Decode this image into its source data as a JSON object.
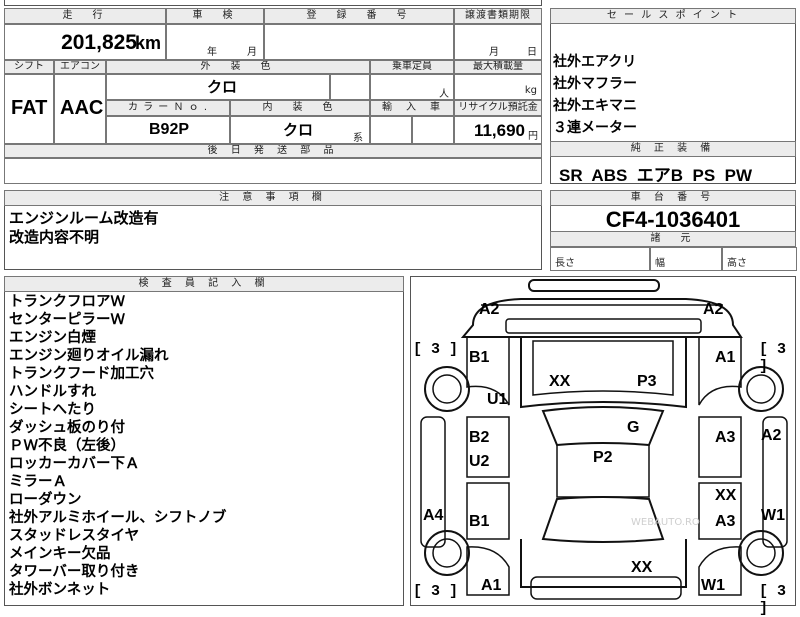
{
  "headers": {
    "mileage": "走　行",
    "inspection": "車　検",
    "registration": "登　録　番　号",
    "transfer_deadline": "譲渡書類期限",
    "sales_point": "セ ー ル ス ポ イ ン ト",
    "shift": "シフト",
    "aircon": "エアコン",
    "exterior_color": "外　装　色",
    "capacity": "乗車定員",
    "max_load": "最大積載量",
    "color_no": "カ ラ ー Ｎ ｏ .",
    "interior_color": "内　装　色",
    "import": "輸　入　車",
    "recycle_fee": "リサイクル預託金",
    "later_parts": "後 日 発 送 部 品",
    "genuine_equipment": "純 正 装 備",
    "notes": "注 意 事 項 欄",
    "chassis_no": "車 台 番 号",
    "specs": "諸　元",
    "inspector": "検 査 員 記 入 欄"
  },
  "values": {
    "mileage": "201,825",
    "mileage_unit": "km",
    "inspection_year": "年",
    "inspection_month": "月",
    "transfer_month": "月",
    "transfer_day": "日",
    "shift": "FAT",
    "aircon": "AAC",
    "exterior_color": "クロ",
    "capacity_unit": "人",
    "max_load_unit": "kg",
    "color_no": "B92P",
    "interior_color": "クロ",
    "interior_suffix": "系",
    "recycle_fee": "11,690",
    "recycle_unit": "円",
    "genuine_equipment": "SR  ABS  エアB  PS  PW",
    "chassis_no": "CF4-1036401",
    "length_label": "長さ",
    "width_label": "幅",
    "height_label": "高さ"
  },
  "sales_points": [
    "社外エアクリ",
    "社外マフラー",
    "社外エキマニ",
    "３連メーター"
  ],
  "notes": [
    "エンジンルーム改造有",
    "改造内容不明"
  ],
  "inspector_notes": [
    "トランクフロアＷ",
    "センターピラーＷ",
    "エンジン白煙",
    "エンジン廻りオイル漏れ",
    "トランクフード加工穴",
    "ハンドルすれ",
    "シートへたり",
    "ダッシュ板のり付",
    "ＰＷ不良（左後）",
    "ロッカーカバー下Ａ",
    "ミラーＡ",
    "ローダウン",
    "社外アルミホイール、シフトノブ",
    "スタッドレスタイヤ",
    "メインキー欠品",
    "タワーバー取り付き",
    "社外ボンネット"
  ],
  "diagram": {
    "marks": {
      "a2_top_left": "A2",
      "a2_top_right": "A2",
      "b1_left": "B1",
      "a1_right": "A1",
      "xx_top": "XX",
      "p3": "P3",
      "u1": "U1",
      "g": "G",
      "b2": "B2",
      "a3_right_mid": "A3",
      "a2_right": "A2",
      "u2": "U2",
      "p2": "P2",
      "xx_right": "XX",
      "a4": "A4",
      "b1_lower": "B1",
      "a3_right_low": "A3",
      "w1_right": "W1",
      "xx_bottom": "XX",
      "a1_bottom": "A1",
      "w1_bottom": "W1"
    },
    "tires": {
      "left_top": "[ 3 ]",
      "right_top": "[ 3 ]",
      "left_bottom": "[ 3 ]",
      "right_bottom": "[ 3 ]"
    },
    "watermark": "WEBAUTO.RO"
  }
}
